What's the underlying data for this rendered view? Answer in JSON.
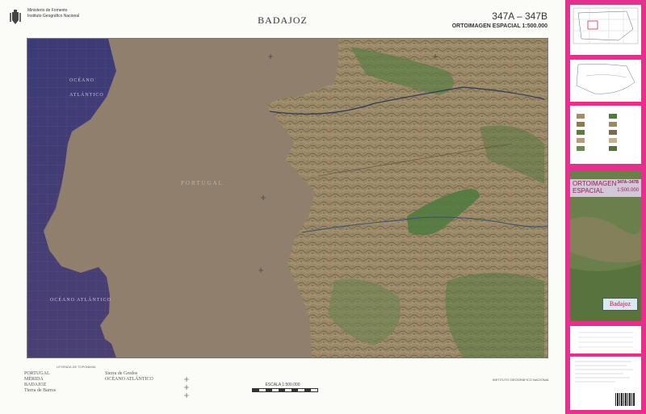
{
  "header": {
    "ministry_line1": "Ministerio de Fomento",
    "ministry_line2": "Instituto Geográfico Nacional",
    "title": "BADAJOZ",
    "sheet_number": "347A – 347B",
    "sheet_subtitle": "ORTOIMAGEN ESPACIAL 1:500.000"
  },
  "map": {
    "labels": {
      "ocean_top_1": "OCÉANO",
      "ocean_top_2": "ATLÁNTICO",
      "country": "PORTUGAL",
      "ocean_bottom": "OCÉANO   ATLÁNTICO"
    },
    "colors": {
      "ocean": "#3f3a73",
      "land_portugal_masked": "#8f7f6c",
      "terrain": "#9a8868",
      "vegetation": "#4e7a3e"
    }
  },
  "footer": {
    "legend_title": "LEYENDA DE TOPONIMIA",
    "names": [
      "PORTUGAL",
      "MÉRIDA",
      "BADAJOZ",
      "Tierra de Barros"
    ],
    "sea_names": [
      "Sierra de Gredos",
      "OCÉANO ATLÁNTICO"
    ],
    "scale_label": "ESCALA 1:500.000",
    "institute": "INSTITUTO GEOGRÁFICO NACIONAL"
  },
  "right_panel": {
    "cover_line1": "ORTOIMAGEN",
    "cover_line2": "ESPACIAL",
    "cover_code": "347A–347B",
    "cover_scale": "1:500.000",
    "cover_name": "Badajoz",
    "brand_color": "#e72f8e"
  }
}
